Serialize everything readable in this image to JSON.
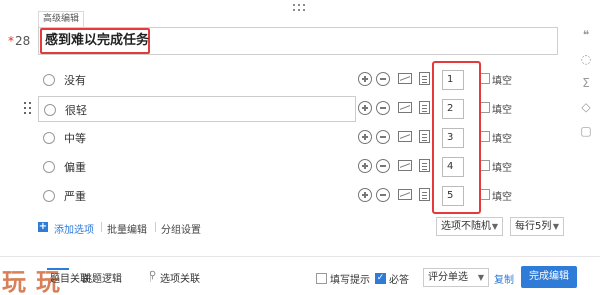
{
  "editor": {
    "advanced_tab": "高级编辑",
    "question_number": "28",
    "required_star": "*",
    "question_title": "感到难以完成任务"
  },
  "right_toolbar": {
    "icons": [
      "quote-icon",
      "visibility-icon",
      "sum-icon",
      "tag-icon",
      "trash-icon"
    ]
  },
  "options": [
    {
      "label": "没有",
      "score": "1",
      "fill_label": "填空"
    },
    {
      "label": "很轻",
      "score": "2",
      "fill_label": "填空"
    },
    {
      "label": "中等",
      "score": "3",
      "fill_label": "填空"
    },
    {
      "label": "偏重",
      "score": "4",
      "fill_label": "填空"
    },
    {
      "label": "严重",
      "score": "5",
      "fill_label": "填空"
    }
  ],
  "option_footer": {
    "add_option": "添加选项",
    "batch_edit": "批量编辑",
    "group_settings": "分组设置",
    "random_select": "选项不随机",
    "columns_select": "每行5列"
  },
  "bottom_bar": {
    "watermark": "玩玩",
    "jump_question": "题目关联",
    "skip_logic": "跳题逻辑",
    "option_link": "选项关联",
    "fill_hint": "填写提示",
    "required": "必答",
    "required_checked": true,
    "question_type": "评分单选",
    "copy": "复制",
    "done": "完成编辑"
  },
  "colors": {
    "accent": "#2e7bd8",
    "highlight": "#e23b3b",
    "watermark": "#d26a3a"
  }
}
